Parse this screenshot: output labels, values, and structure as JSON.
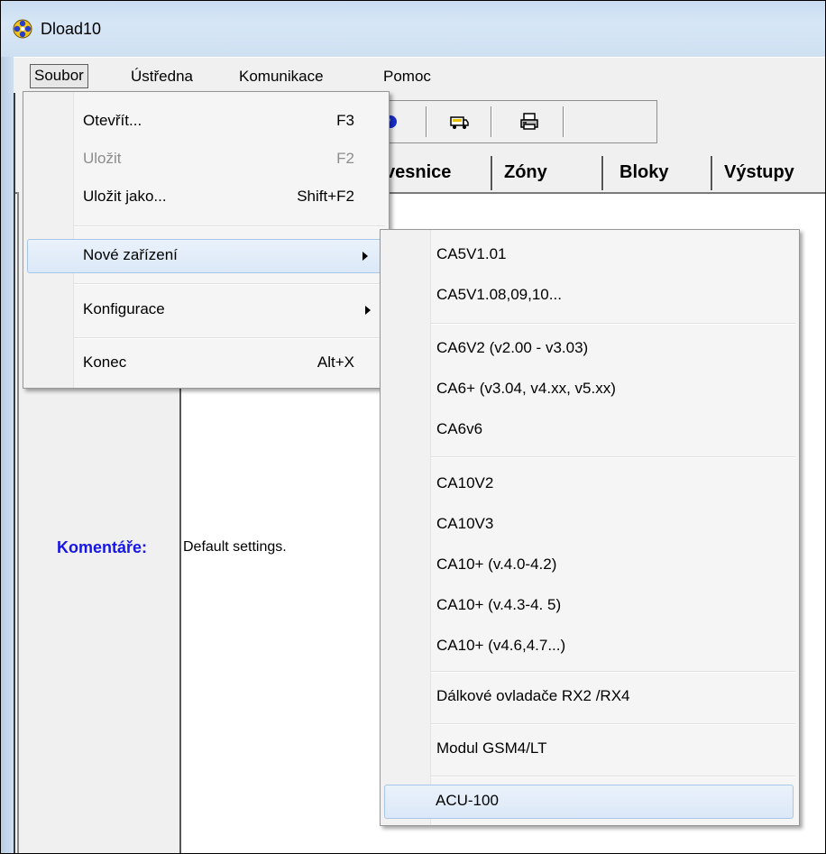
{
  "window": {
    "title": "Dload10"
  },
  "menubar": {
    "items": [
      {
        "label": "Soubor"
      },
      {
        "label": "Ústředna"
      },
      {
        "label": "Komunikace"
      },
      {
        "label": "Pomoc"
      }
    ]
  },
  "tabs": [
    {
      "label": "vesnice"
    },
    {
      "label": "Zóny"
    },
    {
      "label": "Bloky"
    },
    {
      "label": "Výstupy"
    }
  ],
  "content": {
    "komentare_label": "Komentáře:",
    "komentare_value": "Default settings."
  },
  "soubor_menu": {
    "items": [
      {
        "label": "Otevřít...",
        "shortcut": "F3",
        "enabled": true
      },
      {
        "label": "Uložit",
        "shortcut": "F2",
        "enabled": false
      },
      {
        "label": "Uložit jako...",
        "shortcut": "Shift+F2",
        "enabled": true
      },
      {
        "label": "Nové zařízení",
        "submenu": true,
        "highlighted": true
      },
      {
        "label": "Konfigurace",
        "submenu": true
      },
      {
        "label": "Konec",
        "shortcut": "Alt+X",
        "enabled": true
      }
    ]
  },
  "nove_zarizeni_menu": {
    "items": [
      {
        "label": "CA5V1.01"
      },
      {
        "label": "CA5V1.08,09,10..."
      },
      {
        "label": "CA6V2 (v2.00 - v3.03)"
      },
      {
        "label": "CA6+ (v3.04, v4.xx, v5.xx)"
      },
      {
        "label": "CA6v6"
      },
      {
        "label": "CA10V2"
      },
      {
        "label": "CA10V3"
      },
      {
        "label": "CA10+ (v.4.0-4.2)"
      },
      {
        "label": "CA10+ (v.4.3-4. 5)"
      },
      {
        "label": "CA10+ (v4.6,4.7...)"
      },
      {
        "label": "Dálkové ovladače RX2 /RX4"
      },
      {
        "label": "Modul GSM4/LT"
      },
      {
        "label": "ACU-100",
        "highlighted": true
      }
    ]
  },
  "icons": [
    "app-icon",
    "toolbar-connect-icon",
    "toolbar-truck-icon",
    "toolbar-print-icon",
    "submenu-arrow-icon"
  ]
}
